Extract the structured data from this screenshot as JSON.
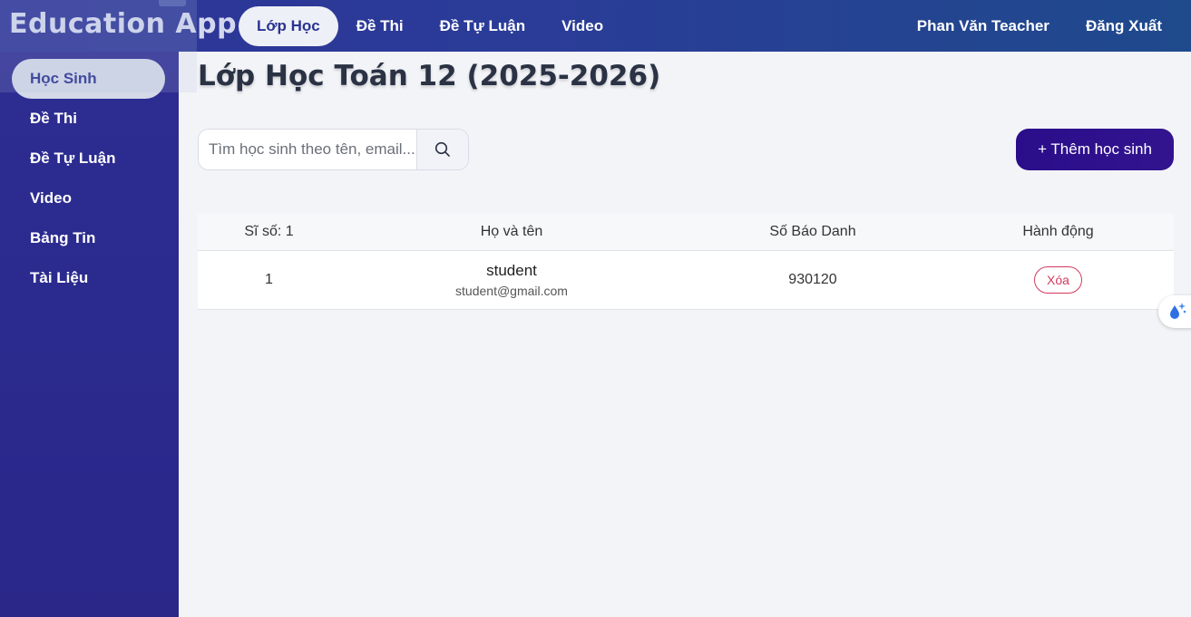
{
  "brand": {
    "title": "Education App"
  },
  "top_nav": {
    "items": [
      {
        "label": "Lớp Học",
        "active": true
      },
      {
        "label": "Đề Thi"
      },
      {
        "label": "Đề Tự Luận"
      },
      {
        "label": "Video"
      }
    ],
    "user_name": "Phan Văn Teacher",
    "logout_label": "Đăng Xuất"
  },
  "sidebar": {
    "items": [
      {
        "label": "Học Sinh",
        "active": true
      },
      {
        "label": "Đề Thi"
      },
      {
        "label": "Đề Tự Luận"
      },
      {
        "label": "Video"
      },
      {
        "label": "Bảng Tin"
      },
      {
        "label": "Tài Liệu"
      }
    ]
  },
  "main": {
    "title": "Lớp Học Toán 12 (2025-2026)",
    "search": {
      "placeholder": "Tìm học sinh theo tên, email..."
    },
    "add_button_label": "+ Thêm học sinh",
    "table": {
      "headers": [
        "Sĩ số: 1",
        "Họ và tên",
        "Số Báo Danh",
        "Hành động"
      ],
      "rows": [
        {
          "index": "1",
          "name": "student",
          "email": "student@gmail.com",
          "candidate_number": "930120",
          "action_label": "Xóa"
        }
      ]
    }
  },
  "colors": {
    "topbar": "#2e3496",
    "sidebar": "#2c2d92",
    "accent_button": "#2a0d8a",
    "delete": "#d23a5e"
  }
}
